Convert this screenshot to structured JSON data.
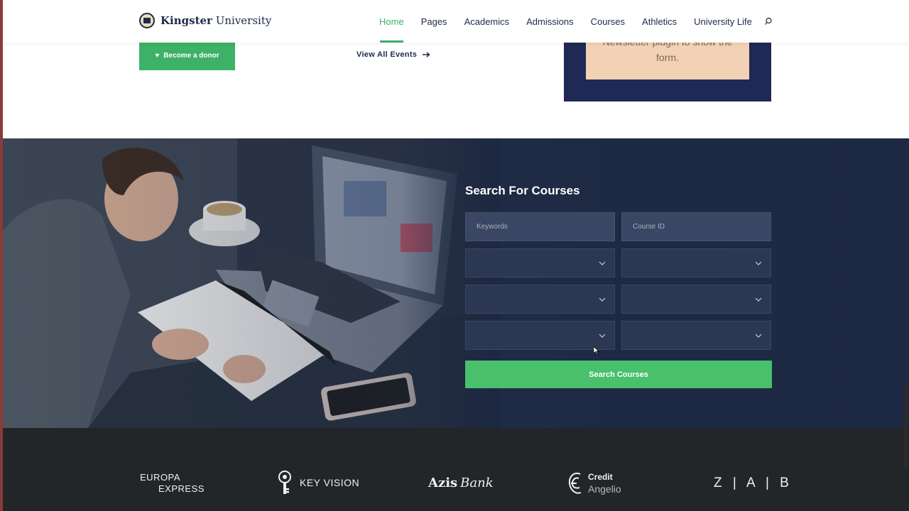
{
  "header": {
    "logo_bold": "Kingster",
    "logo_rest": " University",
    "nav": [
      "Home",
      "Pages",
      "Academics",
      "Admissions",
      "Courses",
      "Athletics",
      "University Life"
    ],
    "active_index": 0
  },
  "top_section": {
    "donor_button": "Become a donor",
    "view_events": "View All Events",
    "newsletter_line1": "Newsletter  plugin to show the",
    "newsletter_line2": "form."
  },
  "course_search": {
    "title": "Search For Courses",
    "keywords_placeholder": "Keywords",
    "course_id_placeholder": "Course ID",
    "button": "Search Courses"
  },
  "partners": {
    "europa_line1": "EUROPA",
    "europa_line2": "EXPRESS",
    "key_vision": "KEY VISION",
    "azis_bold": "Azis",
    "azis_italic": "Bank",
    "credit_line1": "Credit",
    "credit_line2": "Angelio",
    "zab": "Z|A|B"
  },
  "colors": {
    "accent_green": "#3db166",
    "navy": "#1e2a4d",
    "newsletter_bg": "#f3d1b5"
  }
}
